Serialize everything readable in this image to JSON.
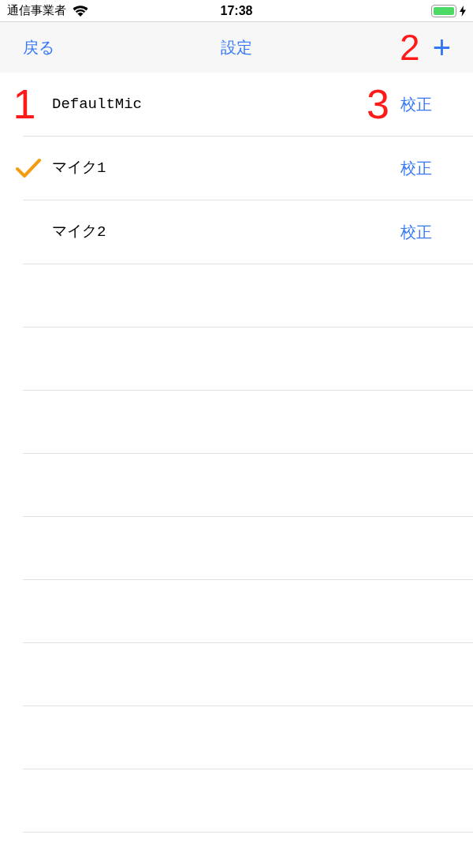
{
  "status_bar": {
    "carrier": "通信事業者",
    "time": "17:38"
  },
  "nav_bar": {
    "back": "戻る",
    "title": "設定",
    "add": "+",
    "add_marker": "2"
  },
  "rows": [
    {
      "name": "DefaultMic",
      "checked": false,
      "action": "校正",
      "marker": "1",
      "action_marker": "3"
    },
    {
      "name": "マイク1",
      "checked": true,
      "action": "校正"
    },
    {
      "name": "マイク2",
      "checked": false,
      "action": "校正"
    }
  ]
}
